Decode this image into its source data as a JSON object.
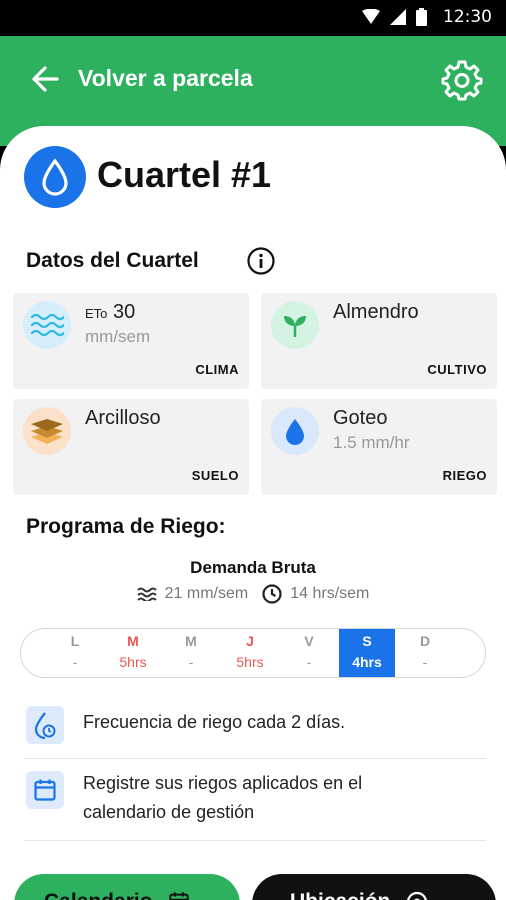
{
  "status_bar": {
    "time": "12:30"
  },
  "app_bar": {
    "title": "Volver a parcela"
  },
  "header": {
    "title": "Cuartel #1"
  },
  "datos": {
    "title": "Datos del Cuartel",
    "cards": [
      {
        "prefix": "ETo",
        "title": "30",
        "subtitle": "mm/sem",
        "tag": "CLIMA"
      },
      {
        "title": "Almendro",
        "subtitle": "",
        "tag": "CULTIVO"
      },
      {
        "title": "Arcilloso",
        "subtitle": "",
        "tag": "SUELO"
      },
      {
        "title": "Goteo",
        "subtitle": "1.5 mm/hr",
        "tag": "RIEGO"
      }
    ]
  },
  "programa": {
    "title": "Programa de Riego:",
    "demand_title": "Demanda Bruta",
    "demand_mm": "21 mm/sem",
    "demand_hrs": "14 hrs/sem",
    "days": [
      {
        "letter": "L",
        "value": "-"
      },
      {
        "letter": "M",
        "value": "5hrs"
      },
      {
        "letter": "M",
        "value": "-"
      },
      {
        "letter": "J",
        "value": "5hrs"
      },
      {
        "letter": "V",
        "value": "-"
      },
      {
        "letter": "S",
        "value": "4hrs"
      },
      {
        "letter": "D",
        "value": "-"
      }
    ],
    "info": [
      {
        "text": "Frecuencia de riego cada 2 días."
      },
      {
        "line1": "Registre sus riegos aplicados en el",
        "line2": "calendario de gestión"
      }
    ]
  },
  "actions": {
    "calendar_label": "Calendario",
    "location_label": "Ubicación"
  },
  "colors": {
    "brand_green": "#2eb15f",
    "accent_blue": "#1a73e8",
    "alert_red": "#e85b52"
  }
}
